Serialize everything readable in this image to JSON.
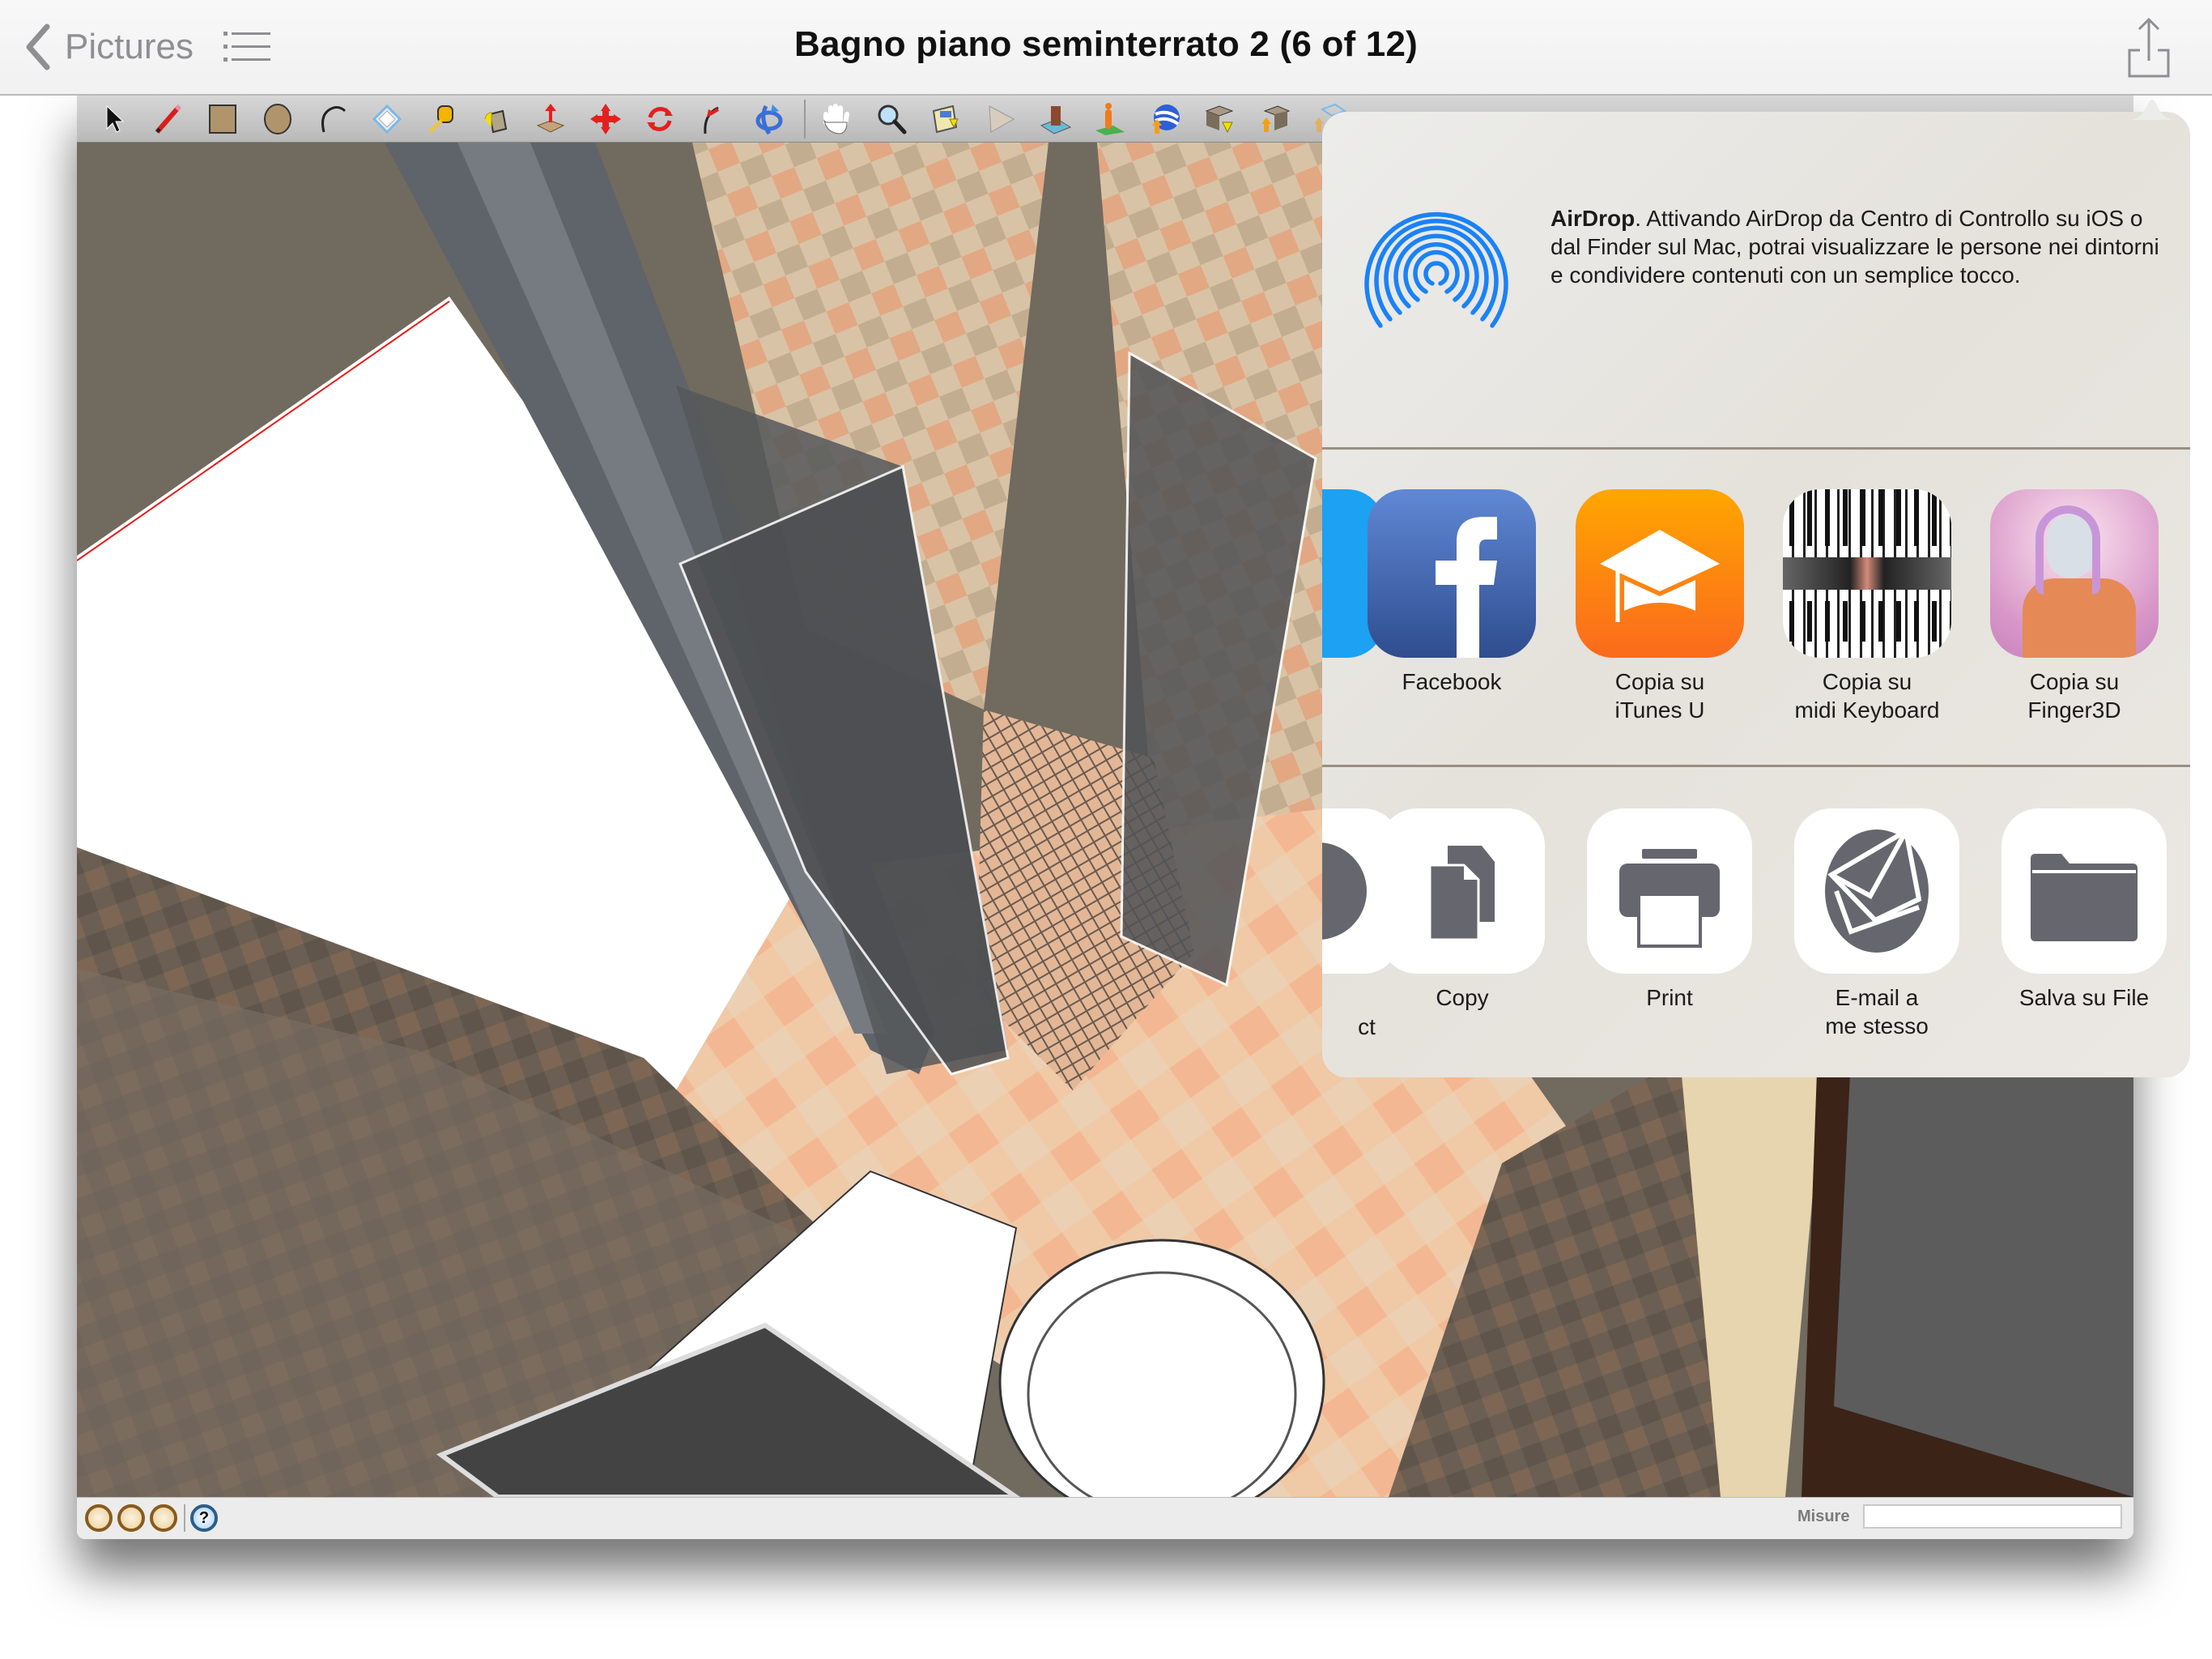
{
  "navbar": {
    "back_label": "Pictures",
    "title": "Bagno piano seminterrato 2 (6 of 12)",
    "icons": {
      "back": "chevron-left-icon",
      "list": "list-icon",
      "share": "share-icon"
    }
  },
  "sketchup": {
    "toolbar_tools": [
      "select",
      "pencil-line",
      "rectangle",
      "circle",
      "arc",
      "eraser",
      "tape-measure",
      "paint-bucket",
      "push-pull",
      "move",
      "rotate",
      "follow-me",
      "orbit",
      "pan",
      "zoom",
      "get-current-view",
      "toggle-terrain",
      "place-model",
      "add-location",
      "preview-google-earth",
      "get-models",
      "share-model",
      "share-component"
    ],
    "status_icons": [
      "geo-location",
      "credits",
      "google-signin",
      "help"
    ],
    "measure_label": "Misure",
    "measure_value": ""
  },
  "share_sheet": {
    "airdrop": {
      "title": "AirDrop",
      "text": "Attivando AirDrop da Centro di Controllo su iOS o dal Finder sul Mac, potrai visualizzare le persone nei dintorni e condividere contenuti con un semplice tocco."
    },
    "apps": [
      {
        "label": "",
        "icon": "twitter-icon"
      },
      {
        "label": "Facebook",
        "icon": "facebook-icon"
      },
      {
        "label": "Copia su\niTunes U",
        "icon": "itunes-u-icon"
      },
      {
        "label": "Copia su\nmidi Keyboard",
        "icon": "midi-keyboard-icon"
      },
      {
        "label": "Copia su\nFinger3D",
        "icon": "finger3d-icon"
      }
    ],
    "actions": [
      {
        "label": "ct",
        "icon": "partial-action-icon"
      },
      {
        "label": "Copy",
        "icon": "copy-icon"
      },
      {
        "label": "Print",
        "icon": "print-icon"
      },
      {
        "label": "E-mail a\nme stesso",
        "icon": "email-icon"
      },
      {
        "label": "Salva su File",
        "icon": "folder-icon"
      }
    ],
    "colors": {
      "airdrop_blue": "#1a82f7",
      "facebook": "#3b5998",
      "itunes_u": "#fd8a0f",
      "action_glyph": "#66666e"
    }
  }
}
